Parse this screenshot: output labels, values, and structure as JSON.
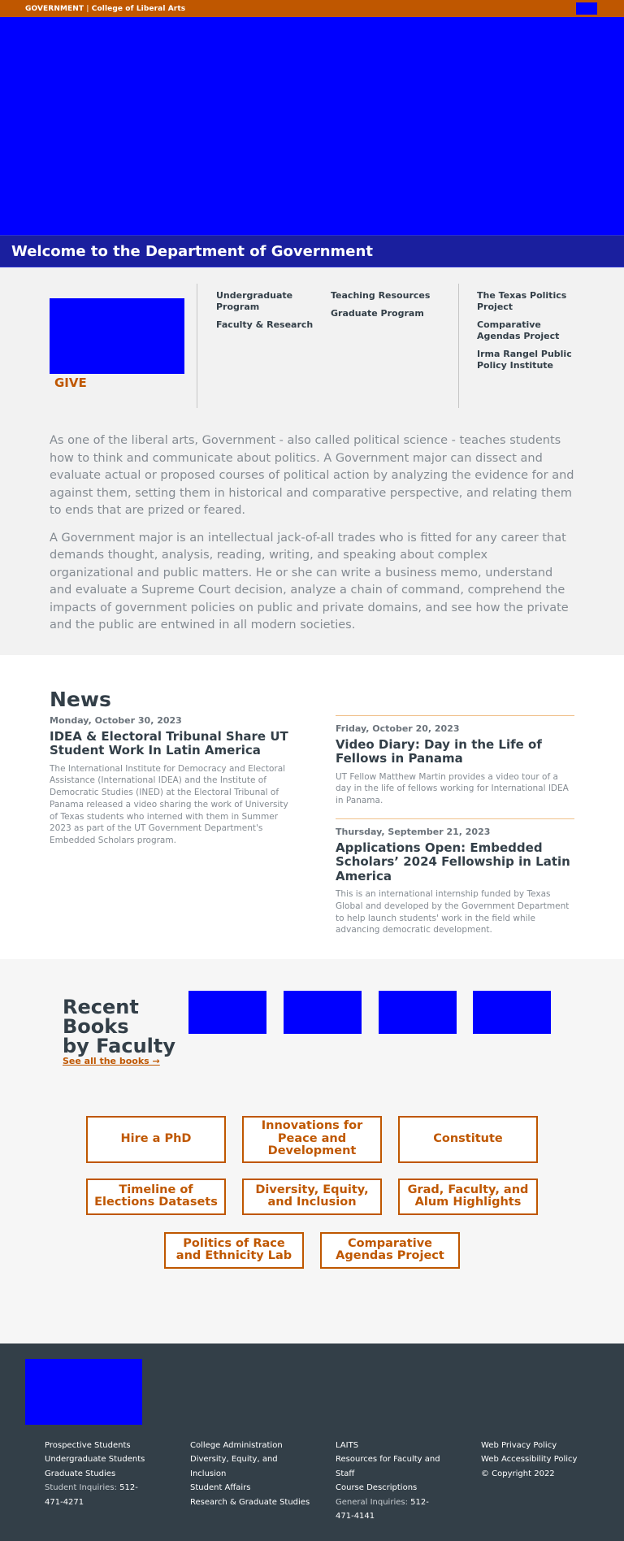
{
  "topbar": {
    "dept": "GOVERNMENT",
    "separator": "|",
    "college": "College of Liberal Arts",
    "menu_button": "menu-icon"
  },
  "welcome": {
    "title": "Welcome to the Department of Government"
  },
  "quicklinks": {
    "give_label": "GIVE",
    "col1": [
      "Undergraduate Program",
      "Faculty & Research"
    ],
    "col2": [
      "Teaching Resources",
      "Graduate Program"
    ],
    "col3": [
      "The Texas Politics Project",
      "Comparative Agendas Project",
      "Irma Rangel Public Policy Institute"
    ]
  },
  "intro": {
    "p1": "As one of the liberal arts, Government - also called political science - teaches students how to think and communicate about politics. A Government major can dissect and evaluate actual or proposed courses of political action by analyzing the evidence for and against them, setting them in historical and comparative perspective, and relating them to ends that are prized or feared.",
    "p2": "A Government major is an intellectual jack-of-all trades who is fitted for any career that demands thought, analysis, reading, writing, and speaking about complex organizational and public matters. He or she can write a business memo, understand and evaluate a Supreme Court decision, analyze a chain of command, comprehend the impacts of government policies on public and private domains, and see how the private and the public are entwined in all modern societies."
  },
  "news": {
    "heading": "News",
    "articles": [
      {
        "date": "Monday, October 30, 2023",
        "title": "IDEA & Electoral Tribunal Share UT Student Work In Latin America",
        "summary": "The International Institute for Democracy and Electoral Assistance (International IDEA) and the Institute of Democratic Studies (INED) at the Electoral Tribunal of Panama released a video sharing the work of University of Texas students who interned with them in Summer 2023 as part of the UT Government Department's Embedded Scholars program."
      },
      {
        "date": "Friday, October 20, 2023",
        "title": "Video Diary: Day in the Life of Fellows in Panama",
        "summary": "UT Fellow Matthew Martin provides a video tour of a day in the life of fellows working for International IDEA in Panama."
      },
      {
        "date": "Thursday, September 21, 2023",
        "title": "Applications Open: Embedded Scholars’ 2024 Fellowship in Latin America",
        "summary": "This is an international internship funded by Texas Global and developed by the Government Department to help launch students' work in the field while advancing democratic development."
      }
    ]
  },
  "books": {
    "title_line1": "Recent",
    "title_line2": "Books",
    "title_line3": "by Faculty",
    "see_all": "See all the books →"
  },
  "programs": [
    "Hire a PhD",
    "Innovations for Peace and Development",
    "Constitute",
    "Timeline of Elections Datasets",
    "Diversity, Equity, and Inclusion",
    "Grad, Faculty, and Alum Highlights",
    "Politics of Race and Ethnicity Lab",
    "Comparative Agendas Project"
  ],
  "footer": {
    "col1": {
      "links": [
        "Prospective Students",
        "Undergraduate Students",
        "Graduate Studies"
      ],
      "phone_label": "Student Inquiries:",
      "phone": "512-471-4271"
    },
    "col2": {
      "links": [
        "College Administration",
        "Diversity, Equity, and Inclusion",
        "Student Affairs",
        "Research & Graduate Studies"
      ]
    },
    "col3": {
      "links": [
        "LAITS",
        "Resources for Faculty and Staff",
        "Course Descriptions"
      ],
      "phone_label": "General Inquiries:",
      "phone": "512-471-4141"
    },
    "col4": {
      "links": [
        "Web Privacy Policy",
        "Web Accessibility Policy"
      ],
      "copyright": "© Copyright 2022"
    }
  },
  "colors": {
    "brand_orange": "#bf5700",
    "charcoal": "#333f48",
    "placeholder_blue": "#0000ff",
    "welcome_band": "#1a1f9e"
  }
}
